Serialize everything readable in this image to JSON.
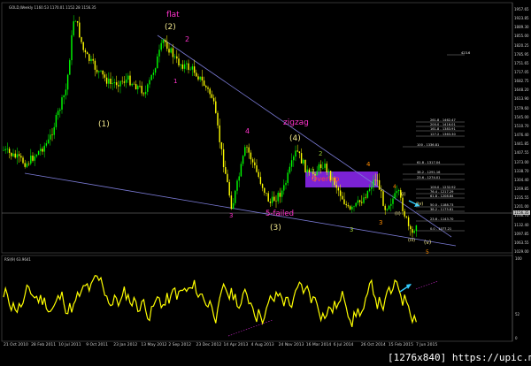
{
  "window": {
    "title": "GOLD,Weekly 1160.53 1170.01 1152.28 1156.35"
  },
  "price_pane": {
    "axis_labels": [
      "1957.65",
      "1923.85",
      "1889.30",
      "1855.00",
      "1820.25",
      "1785.95",
      "1751.65",
      "1717.05",
      "1682.75",
      "1648.20",
      "1613.90",
      "1579.60",
      "1545.00",
      "1510.70",
      "1476.40",
      "1441.85",
      "1407.55",
      "1373.00",
      "1338.70",
      "1304.40",
      "1269.85",
      "1235.55",
      "1201.00",
      "1166.70",
      "1132.40",
      "1097.85",
      "1063.55",
      "1029.00"
    ],
    "current_price": "1156.35",
    "wave_labels": [
      {
        "text": "flat",
        "color": "#ff33cc"
      },
      {
        "text": "(2)",
        "color": "#f0e68c"
      },
      {
        "text": "2",
        "color": "#ff33cc"
      },
      {
        "text": "1",
        "color": "#ff33cc"
      },
      {
        "text": "(1)",
        "color": "#f0e68c"
      },
      {
        "text": "zigzag",
        "color": "#ff33cc"
      },
      {
        "text": "4",
        "color": "#ff33cc"
      },
      {
        "text": "(4)",
        "color": "#f0e68c"
      },
      {
        "text": "3",
        "color": "#ff33cc"
      },
      {
        "text": "5-failed",
        "color": "#ff33cc"
      },
      {
        "text": "(3)",
        "color": "#f0e68c"
      },
      {
        "text": "2",
        "color": "#9acd32"
      },
      {
        "text": "1",
        "color": "#9acd32"
      },
      {
        "text": "3",
        "color": "#9acd32"
      },
      {
        "text": "4",
        "color": "#ff8c00"
      },
      {
        "text": "3",
        "color": "#ff8c00"
      },
      {
        "text": "4",
        "color": "#ff8c00"
      },
      {
        "text": "(i)",
        "color": "#f0e68c"
      },
      {
        "text": "(ii)",
        "color": "#f0e68c"
      },
      {
        "text": "(iii)",
        "color": "#f0e68c"
      },
      {
        "text": "(iv)",
        "color": "#f0e68c"
      },
      {
        "text": "(v)",
        "color": "#f0e68c"
      },
      {
        "text": "5",
        "color": "#ff8c00"
      },
      {
        "text": "Overlap",
        "color": "#ff4040"
      }
    ],
    "fib_levels": [
      {
        "label": "423.6"
      },
      {
        "label": "261.8 - 1462.47"
      },
      {
        "label": "200.0 - 1416.01"
      },
      {
        "label": "161.8 - 1383.91"
      },
      {
        "label": "127.2 - 1363.30"
      },
      {
        "label": "100 - 1336.81"
      },
      {
        "label": "61.8 - 1317.04"
      },
      {
        "label": "38.2 - 1291.16"
      },
      {
        "label": "23.6 - 1274.01"
      },
      {
        "label": "100.0 - 1232.92"
      },
      {
        "label": "76.4 - 1217.29"
      },
      {
        "label": "61.8 - 1208.84"
      },
      {
        "label": "50.0 - 1188.73"
      },
      {
        "label": "38.2 - 1175.81"
      },
      {
        "label": "23.6 - 1143.70"
      },
      {
        "label": "0.0 - 1077.21"
      }
    ]
  },
  "rsi_pane": {
    "title": "RSI(9) 63.9641",
    "axis_labels": [
      "100",
      "52",
      "0"
    ]
  },
  "time_axis": [
    "21 Oct 2010",
    "28 Feb 2011",
    "10 Jul 2011",
    "9 Oct 2011",
    "23 Jan 2012",
    "13 May 2012",
    "2 Sep 2012",
    "23 Dec 2012",
    "14 Apr 2013",
    "4 Aug 2013",
    "24 Nov 2013",
    "16 Mar 2014",
    "6 Jul 2014",
    "26 Oct 2014",
    "15 Feb 2015",
    "7 Jun 2015"
  ],
  "watermark": "[1276x840] https://upic.me/",
  "colors": {
    "background": "#000000",
    "bull_candle": "#00ff00",
    "bear_candle": "#ffff00",
    "rsi_line": "#ffff00",
    "trendline": "#7b7bd6",
    "overlap_box": "#8a2be2",
    "arrow": "#33ccff"
  }
}
